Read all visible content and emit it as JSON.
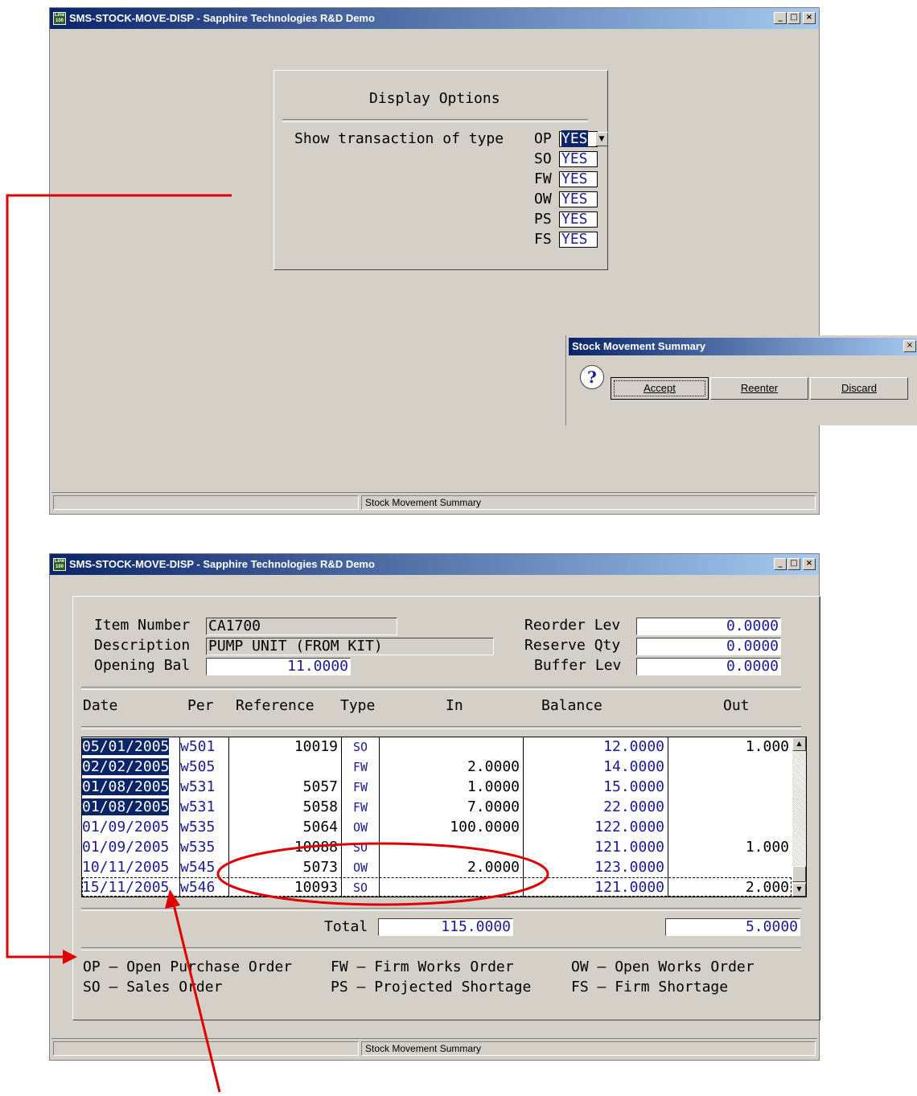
{
  "window_title": "SMS-STOCK-MOVE-DISP - Sapphire Technologies R&D Demo",
  "app_icon_text": "Line 100",
  "window_controls": {
    "minimize": "_",
    "maximize": "□",
    "close": "×"
  },
  "status_text": "Stock Movement Summary",
  "display_options": {
    "title": "Display Options",
    "prompt": "Show transaction of type",
    "types": [
      {
        "code": "OP",
        "value": "YES"
      },
      {
        "code": "SO",
        "value": "YES"
      },
      {
        "code": "FW",
        "value": "YES"
      },
      {
        "code": "OW",
        "value": "YES"
      },
      {
        "code": "PS",
        "value": "YES"
      },
      {
        "code": "FS",
        "value": "YES"
      }
    ]
  },
  "dialog": {
    "title": "Stock Movement Summary",
    "close": "×",
    "icon": "?",
    "accept": "Accept",
    "reenter": "Reenter",
    "discard": "Discard"
  },
  "item": {
    "item_number_label": "Item Number",
    "item_number": "CA1700",
    "description_label": "Description",
    "description": "PUMP UNIT (FROM KIT)",
    "opening_bal_label": "Opening Bal",
    "opening_bal": "11.0000",
    "reorder_lev_label": "Reorder Lev",
    "reorder_lev": "0.0000",
    "reserve_qty_label": "Reserve Qty",
    "reserve_qty": "0.0000",
    "buffer_lev_label": "Buffer Lev",
    "buffer_lev": "0.0000"
  },
  "columns": {
    "date": "Date",
    "per": "Per",
    "reference": "Reference",
    "type": "Type",
    "in": "In",
    "balance": "Balance",
    "out": "Out"
  },
  "rows": [
    {
      "date": "05/01/2005",
      "per": "w501",
      "ref": "10019",
      "type": "SO",
      "in": "",
      "balance": "12.0000",
      "out": "1.000"
    },
    {
      "date": "02/02/2005",
      "per": "w505",
      "ref": "",
      "type": "FW",
      "in": "2.0000",
      "balance": "14.0000",
      "out": ""
    },
    {
      "date": "01/08/2005",
      "per": "w531",
      "ref": "5057",
      "type": "FW",
      "in": "1.0000",
      "balance": "15.0000",
      "out": ""
    },
    {
      "date": "01/08/2005",
      "per": "w531",
      "ref": "5058",
      "type": "FW",
      "in": "7.0000",
      "balance": "22.0000",
      "out": ""
    },
    {
      "date": "01/09/2005",
      "per": "w535",
      "ref": "5064",
      "type": "OW",
      "in": "100.0000",
      "balance": "122.0000",
      "out": ""
    },
    {
      "date": "01/09/2005",
      "per": "w535",
      "ref": "10088",
      "type": "SO",
      "in": "",
      "balance": "121.0000",
      "out": "1.000"
    },
    {
      "date": "10/11/2005",
      "per": "w545",
      "ref": "5073",
      "type": "OW",
      "in": "2.0000",
      "balance": "123.0000",
      "out": ""
    },
    {
      "date": "15/11/2005",
      "per": "w546",
      "ref": "10093",
      "type": "SO",
      "in": "",
      "balance": "121.0000",
      "out": "2.000"
    }
  ],
  "scroll": {
    "up": "▲",
    "down": "▼"
  },
  "totals": {
    "label": "Total",
    "in": "115.0000",
    "out": "5.0000"
  },
  "legend": [
    {
      "code": "OP",
      "sep": "—",
      "text": "Open Purchase Order"
    },
    {
      "code": "FW",
      "sep": "—",
      "text": "Firm Works Order"
    },
    {
      "code": "OW",
      "sep": "—",
      "text": "Open Works Order"
    },
    {
      "code": "SO",
      "sep": "—",
      "text": "Sales Order"
    },
    {
      "code": "PS",
      "sep": "—",
      "text": "Projected Shortage"
    },
    {
      "code": "FS",
      "sep": "—",
      "text": "Firm Shortage"
    }
  ],
  "annotation_color": "#e00000",
  "highlight_color": "#0a246a"
}
